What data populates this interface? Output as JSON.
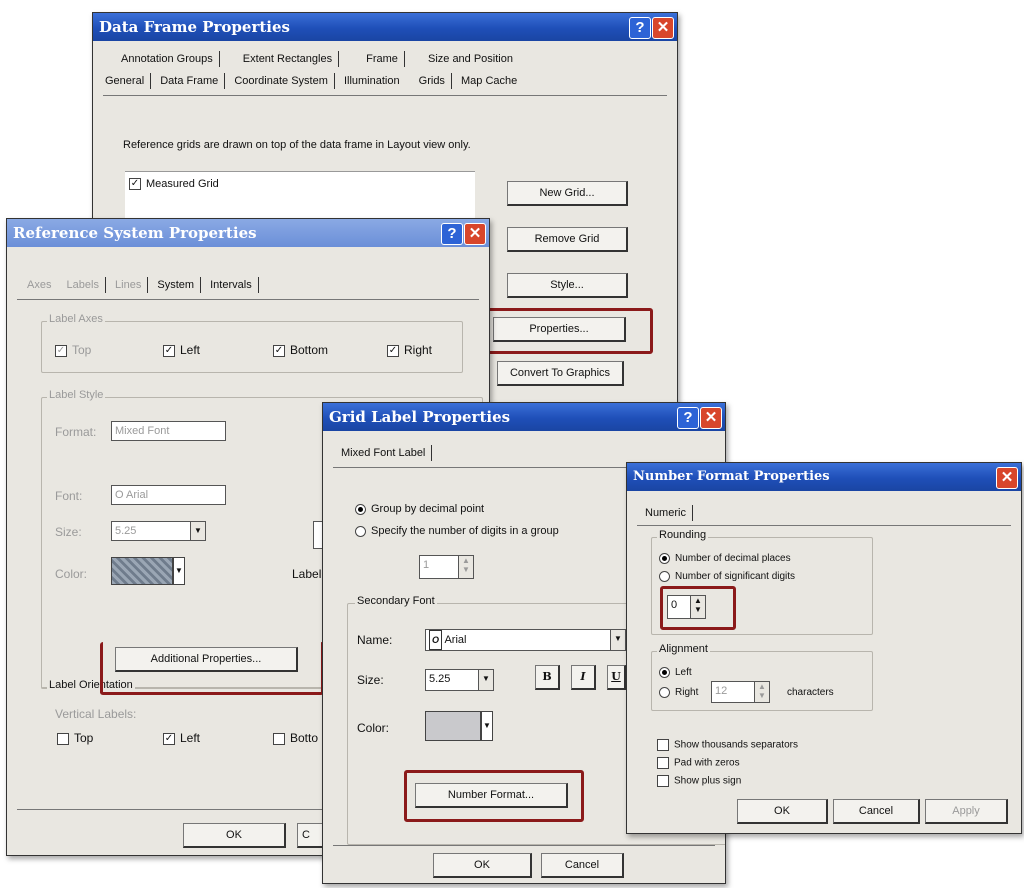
{
  "data_frame": {
    "title": "Data Frame Properties",
    "tabs_row1": [
      "Annotation Groups",
      "Extent Rectangles",
      "Frame",
      "Size and Position"
    ],
    "tabs_row2": [
      "General",
      "Data Frame",
      "Coordinate System",
      "Illumination",
      "Grids",
      "Map Cache"
    ],
    "description": "Reference grids are drawn on top of the data frame in Layout view only.",
    "grid_item": "Measured Grid",
    "buttons": {
      "new_grid": "New Grid...",
      "remove_grid": "Remove Grid",
      "style": "Style...",
      "properties": "Properties...",
      "convert": "Convert To Graphics"
    }
  },
  "ref_system": {
    "title": "Reference System Properties",
    "tabs": [
      "Axes",
      "Labels",
      "Lines",
      "System",
      "Intervals"
    ],
    "label_axes": {
      "group": "Label Axes",
      "top": "Top",
      "left": "Left",
      "bottom": "Bottom",
      "right": "Right"
    },
    "label_style": {
      "group": "Label Style",
      "format_label": "Format:",
      "format_value": "Mixed Font",
      "font_label": "Font:",
      "font_value": "O Arial",
      "size_label": "Size:",
      "size_value": "5.25",
      "color_label": "Color:",
      "label_cut": "Label"
    },
    "additional_button": "Additional Properties...",
    "orientation": {
      "group": "Label Orientation",
      "vertical": "Vertical Labels:",
      "top": "Top",
      "left": "Left",
      "bottom": "Botto"
    },
    "ok": "OK",
    "cancel_cut": "C"
  },
  "grid_label": {
    "title": "Grid Label Properties",
    "tab": "Mixed Font Label",
    "group_by": "Group by decimal point",
    "specify": "Specify the number of digits in a group",
    "spin_value": "1",
    "secondary_group": "Secondary Font",
    "name_label": "Name:",
    "name_value": "Arial",
    "size_label": "Size:",
    "size_value": "5.25",
    "bold": "B",
    "italic": "I",
    "underline": "U",
    "color_label": "Color:",
    "number_format_button": "Number Format...",
    "ok": "OK",
    "cancel": "Cancel"
  },
  "number_format": {
    "title": "Number Format Properties",
    "tab": "Numeric",
    "rounding": {
      "group": "Rounding",
      "decimal": "Number of decimal places",
      "significant": "Number of significant digits",
      "value": "0"
    },
    "alignment": {
      "group": "Alignment",
      "left": "Left",
      "right": "Right",
      "chars_value": "12",
      "characters": "characters"
    },
    "options": {
      "thousands": "Show thousands separators",
      "pad": "Pad with zeros",
      "plus": "Show plus sign"
    },
    "ok": "OK",
    "cancel": "Cancel",
    "apply": "Apply"
  },
  "icons": {
    "help": "?",
    "close": "✕",
    "check": "✓",
    "arrow_down": "▼",
    "arrow_up": "▲"
  },
  "colors": {
    "titlebar": "#1f4fb8",
    "highlight": "#8b1a1a",
    "dialog_bg": "#e9e7e1"
  }
}
